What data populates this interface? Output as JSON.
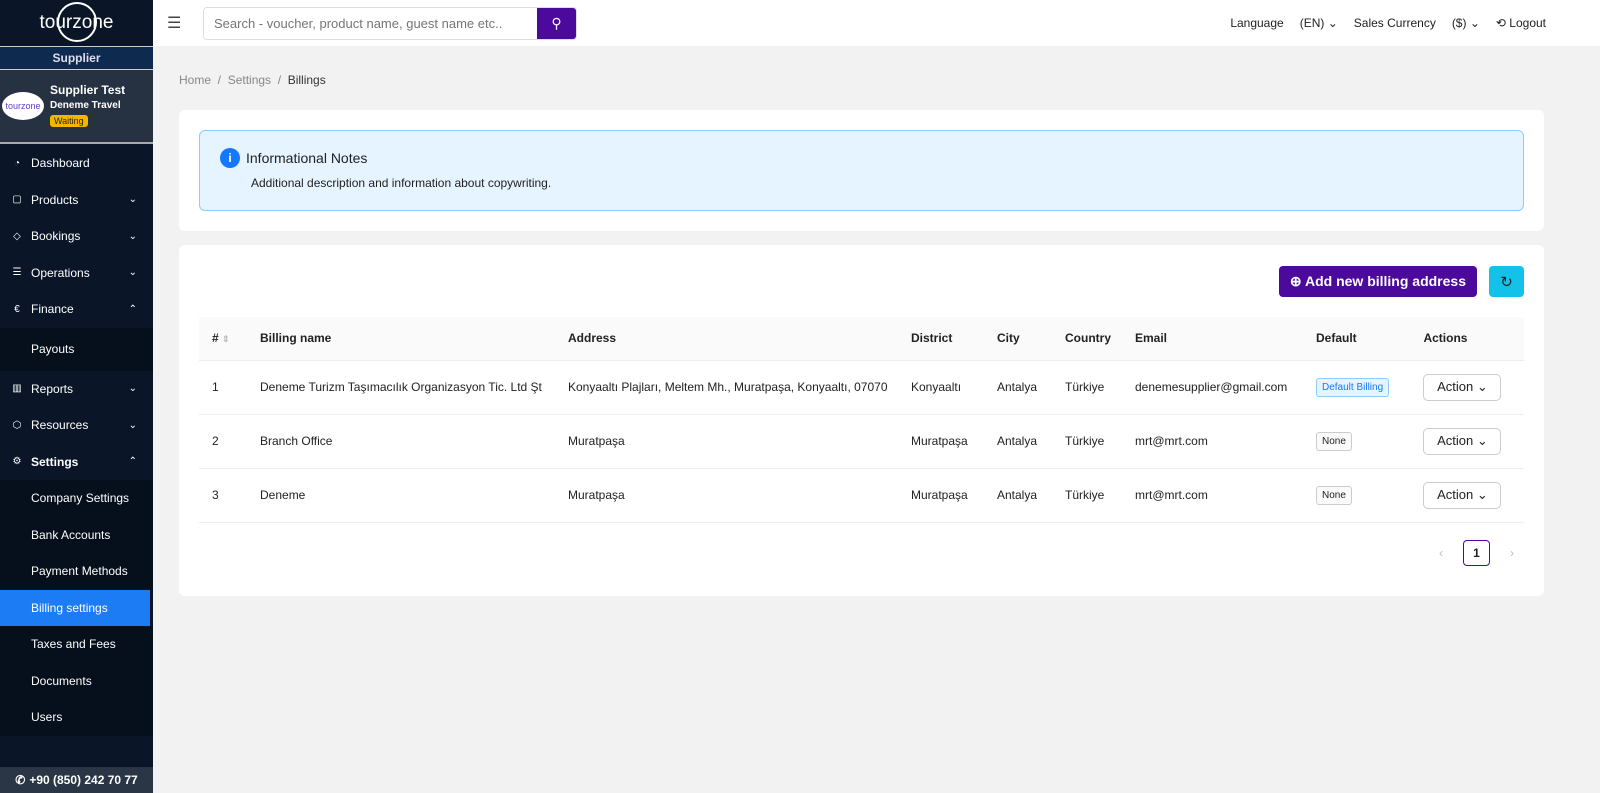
{
  "brand": "tourzone",
  "sidebar": {
    "role": "Supplier",
    "user_name": "Supplier Test",
    "company": "Deneme Travel",
    "status": "Waiting",
    "items": [
      {
        "label": "Dashboard",
        "icon": "gauge"
      },
      {
        "label": "Products",
        "icon": "bag"
      },
      {
        "label": "Bookings",
        "icon": "tag"
      },
      {
        "label": "Operations",
        "icon": "list"
      },
      {
        "label": "Finance",
        "icon": "euro"
      },
      {
        "label": "Payouts"
      },
      {
        "label": "Reports",
        "icon": "bar-chart"
      },
      {
        "label": "Resources",
        "icon": "box"
      },
      {
        "label": "Settings",
        "icon": "gear"
      },
      {
        "label": "Company Settings"
      },
      {
        "label": "Bank Accounts"
      },
      {
        "label": "Payment Methods"
      },
      {
        "label": "Billing settings"
      },
      {
        "label": "Taxes and Fees"
      },
      {
        "label": "Documents"
      },
      {
        "label": "Users"
      }
    ],
    "phone": "+90 (850) 242 70 77"
  },
  "header": {
    "search_placeholder": "Search - voucher, product name, guest name etc..",
    "language_label": "Language",
    "language": "(EN)",
    "currency_label": "Sales Currency",
    "currency": "($)",
    "logout": "Logout"
  },
  "breadcrumb": [
    "Home",
    "Settings",
    "Billings"
  ],
  "info": {
    "title": "Informational Notes",
    "description": "Additional description and information about copywriting."
  },
  "toolbar": {
    "add_label": "Add new billing address"
  },
  "table": {
    "columns": [
      "#",
      "Billing name",
      "Address",
      "District",
      "City",
      "Country",
      "Email",
      "Default",
      "Actions"
    ],
    "rows": [
      {
        "n": "1",
        "name": "Deneme Turizm Taşımacılık Organizasyon Tic. Ltd Şt",
        "address": "Konyaaltı Plajları, Meltem Mh., Muratpaşa, Konyaaltı, 07070",
        "district": "Konyaaltı",
        "city": "Antalya",
        "country": "Türkiye",
        "email": "denemesupplier@gmail.com",
        "default": "Default Billing",
        "action": "Action"
      },
      {
        "n": "2",
        "name": "Branch Office",
        "address": "Muratpaşa",
        "district": "Muratpaşa",
        "city": "Antalya",
        "country": "Türkiye",
        "email": "mrt@mrt.com",
        "default": "None",
        "action": "Action"
      },
      {
        "n": "3",
        "name": "Deneme",
        "address": "Muratpaşa",
        "district": "Muratpaşa",
        "city": "Antalya",
        "country": "Türkiye",
        "email": "mrt@mrt.com",
        "default": "None",
        "action": "Action"
      }
    ]
  },
  "pagination": {
    "current": "1"
  }
}
